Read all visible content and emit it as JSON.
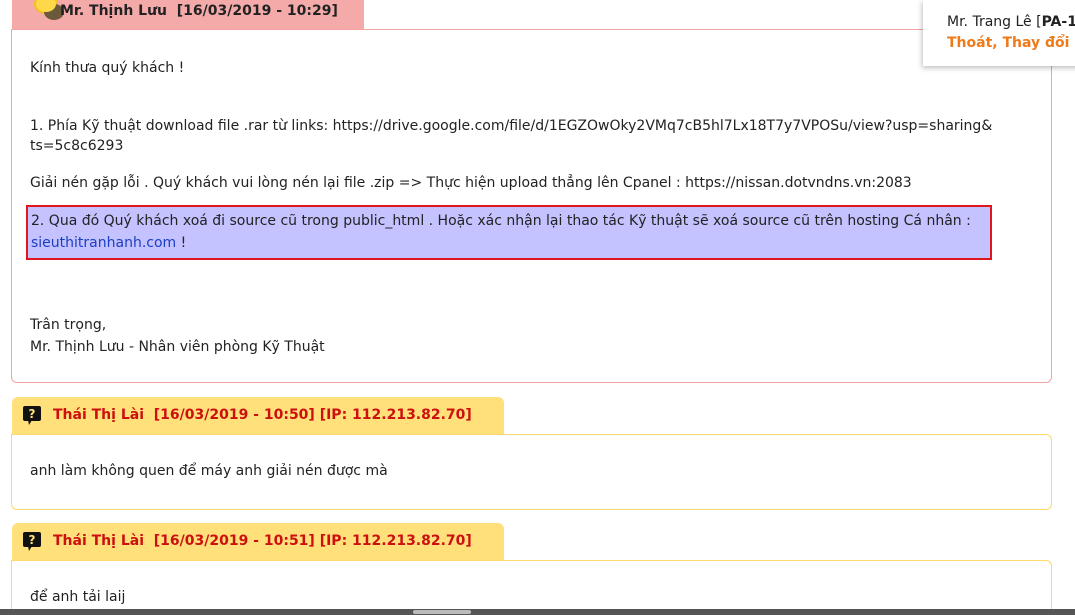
{
  "staff_message": {
    "author": "Mr. Thịnh Lưu",
    "datetime": "[16/03/2019 - 10:29]",
    "greeting": "Kính thưa quý khách !",
    "line1_a": "1. Phía Kỹ thuật download file .rar từ links: https://drive.google.com/file/d/1EGZOwOky2VMq7cB5hl7Lx18T7y7VPOSu/view?usp=sharing&",
    "line1_b": "ts=5c8c6293",
    "line2": "Giải nén gặp lỗi . Quý khách vui lòng nén lại file .zip => Thực hiện upload thẳng lên Cpanel : https://nissan.dotvndns.vn:2083",
    "highlight_text": "2. Qua đó Quý khách xoá đi source cũ trong public_html . Hoặc xác nhận lại thao tác Kỹ thuật sẽ xoá source cũ trên hosting Cá nhân :",
    "highlight_link": "sieuthitranhanh.com",
    "highlight_end": " !",
    "closing": "Trân trọng,",
    "signature": "Mr. Thịnh Lưu - Nhân viên phòng Kỹ Thuật"
  },
  "customer_messages": [
    {
      "author": "Thái Thị Lài",
      "meta": "[16/03/2019 - 10:50] [IP: 112.213.82.70]",
      "text": "anh làm không quen để máy anh giải nén được mà"
    },
    {
      "author": "Thái Thị Lài",
      "meta": "[16/03/2019 - 10:51] [IP: 112.213.82.70]",
      "text": "để anh tải laij"
    }
  ],
  "user_panel": {
    "name_prefix": "Mr. Trang Lê [",
    "code": "PA-1",
    "logout": "Thoát",
    "separator": ", ",
    "change": "Thay đổi"
  },
  "colors": {
    "staff_header": "#f5aaaa",
    "customer_header": "#ffe07a",
    "highlight_bg": "#c4c2ff",
    "highlight_border": "#e0161e",
    "customer_name": "#cc1010",
    "link": "#1a3fc2",
    "user_links": "#ef7a1a"
  },
  "icons": {
    "staff": "chat-bubble-icon",
    "customer": "question-icon"
  }
}
